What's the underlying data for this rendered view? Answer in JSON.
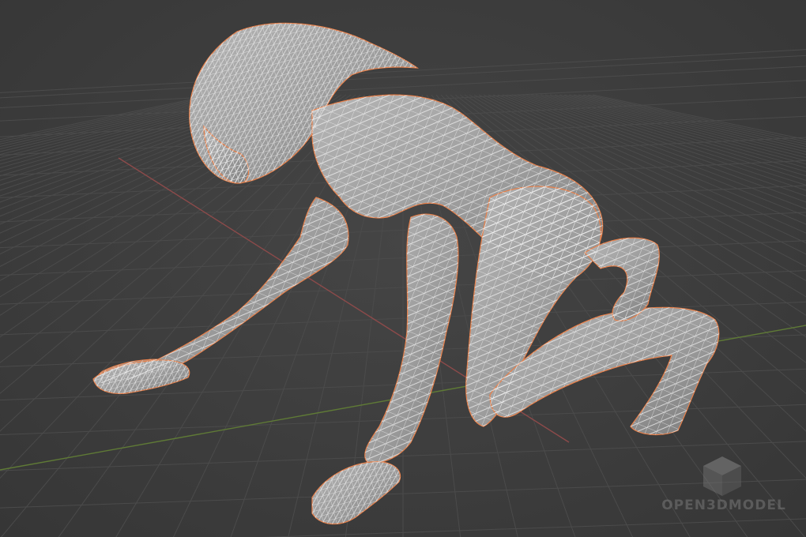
{
  "viewport": {
    "background": "#3d3d3d",
    "grid_color": "#4b4b4b",
    "x_axis_color": "#8c4a4a",
    "y_axis_color": "#5f7a36"
  },
  "model": {
    "object": "alien-creature-wireframe",
    "surface_color": "#9a9a9a",
    "wire_color": "#f2f2f2",
    "outline_color": "#e8804a"
  },
  "watermark": {
    "text": "OPEN3DMODEL",
    "icon": "cube-icon"
  }
}
